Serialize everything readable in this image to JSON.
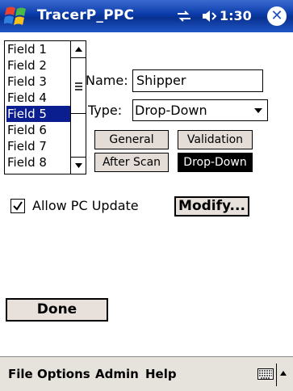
{
  "title_bar": {
    "app_title": "TracerP_PPC",
    "time": "1:30",
    "close_label": "✕",
    "colors": {
      "background": "#0a3aa8",
      "text": "#ffffff"
    }
  },
  "field_list": {
    "items": [
      "Field 1",
      "Field 2",
      "Field 3",
      "Field 4",
      "Field 5",
      "Field 6",
      "Field 7",
      "Field 8"
    ],
    "selected": "Field 5",
    "selection_color": "#0a1e8f"
  },
  "form": {
    "name_label": "Name:",
    "name_value": "Shipper",
    "type_label": "Type:",
    "type_value": "Drop-Down"
  },
  "tabs": {
    "general": "General",
    "validation": "Validation",
    "after_scan": "After Scan",
    "drop_down": "Drop-Down",
    "active": "Drop-Down"
  },
  "options": {
    "allow_pc_update_label": "Allow PC Update",
    "allow_pc_update_checked": true,
    "modify_label": "Modify..."
  },
  "actions": {
    "done_label": "Done"
  },
  "menu_bar": {
    "items": [
      "File",
      "Options",
      "Admin",
      "Help"
    ],
    "icons": [
      "keyboard-icon",
      "sip-up-arrow-icon"
    ]
  }
}
